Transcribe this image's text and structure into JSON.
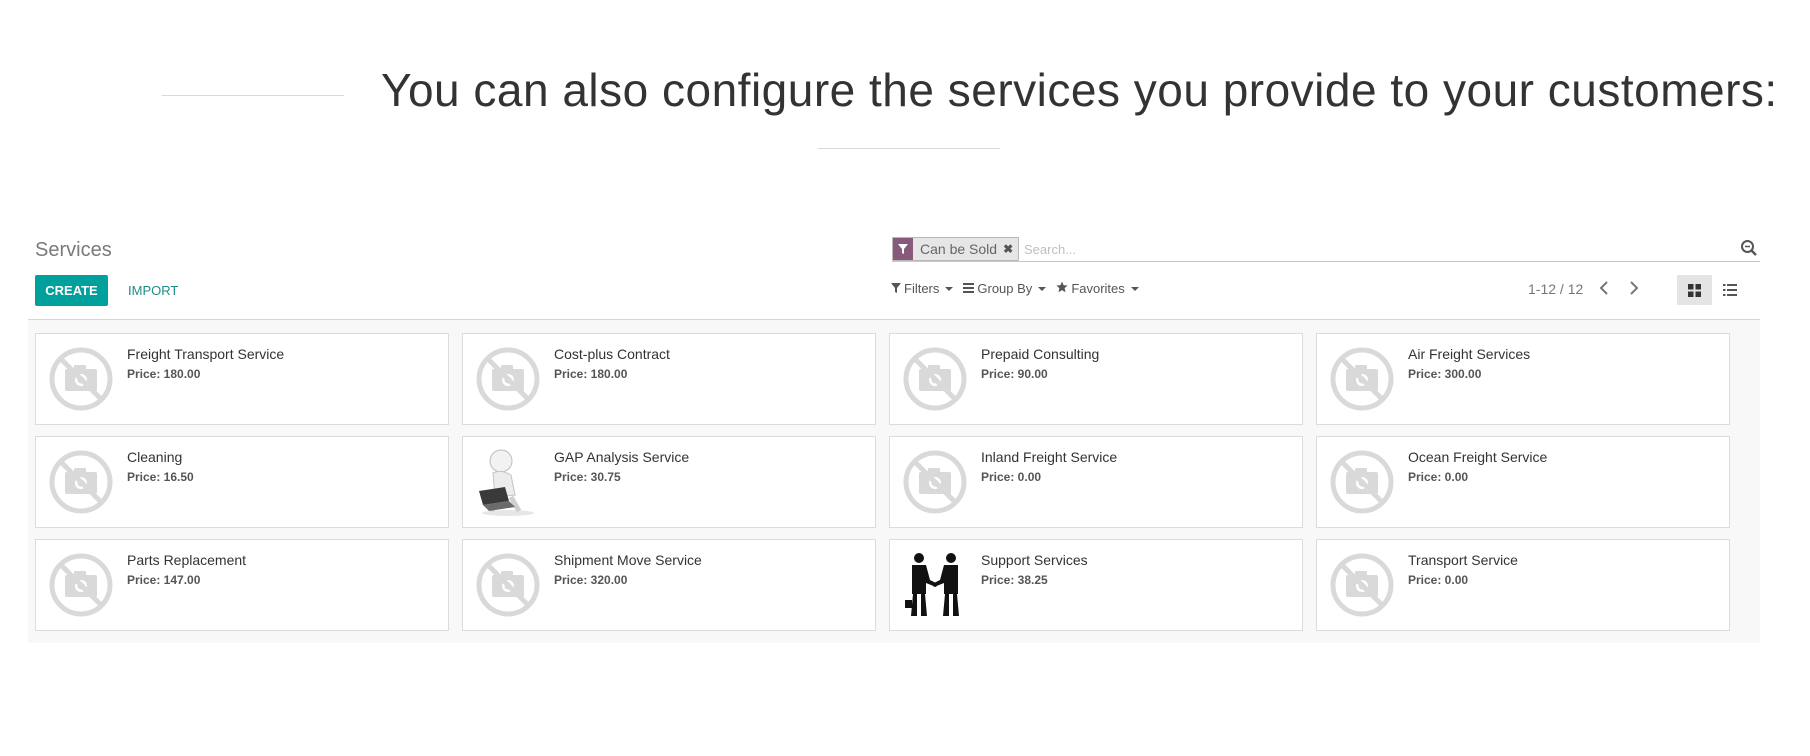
{
  "headline": "You can also configure the services you provide to your customers:",
  "control_panel": {
    "title": "Services",
    "create_label": "CREATE",
    "import_label": "IMPORT",
    "search": {
      "facet_label": "Can be Sold",
      "placeholder": "Search..."
    },
    "filters_label": "Filters",
    "groupby_label": "Group By",
    "favorites_label": "Favorites",
    "pager_text": "1-12 / 12",
    "active_view": "kanban"
  },
  "colors": {
    "primary": "#00a09d",
    "facet": "#875a7b"
  },
  "price_prefix": "Price:",
  "services": [
    {
      "name": "Freight Transport Service",
      "price": "180.00",
      "image": "no-photo-icon"
    },
    {
      "name": "Cost-plus Contract",
      "price": "180.00",
      "image": "no-photo-icon"
    },
    {
      "name": "Prepaid Consulting",
      "price": "90.00",
      "image": "no-photo-icon"
    },
    {
      "name": "Air Freight Services",
      "price": "300.00",
      "image": "no-photo-icon"
    },
    {
      "name": "Cleaning",
      "price": "16.50",
      "image": "no-photo-icon"
    },
    {
      "name": "GAP Analysis Service",
      "price": "30.75",
      "image": "person-laptop-image"
    },
    {
      "name": "Inland Freight Service",
      "price": "0.00",
      "image": "no-photo-icon"
    },
    {
      "name": "Ocean Freight Service",
      "price": "0.00",
      "image": "no-photo-icon"
    },
    {
      "name": "Parts Replacement",
      "price": "147.00",
      "image": "no-photo-icon"
    },
    {
      "name": "Shipment Move Service",
      "price": "320.00",
      "image": "no-photo-icon"
    },
    {
      "name": "Support Services",
      "price": "38.25",
      "image": "handshake-image"
    },
    {
      "name": "Transport Service",
      "price": "0.00",
      "image": "no-photo-icon"
    }
  ]
}
